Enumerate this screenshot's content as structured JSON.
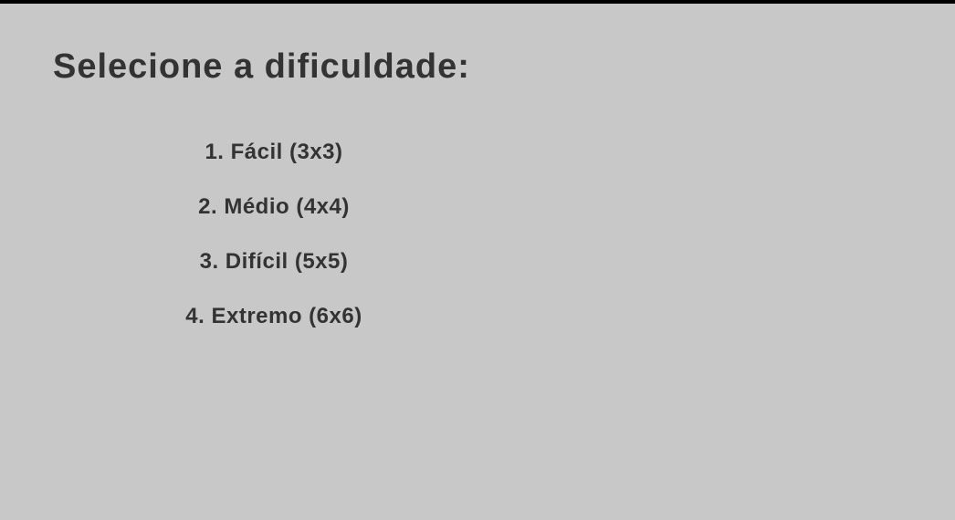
{
  "menu": {
    "title": "Selecione a dificuldade:",
    "options": [
      {
        "label": "1. Fácil (3x3)"
      },
      {
        "label": "2. Médio (4x4)"
      },
      {
        "label": "3. Difícil (5x5)"
      },
      {
        "label": "4. Extremo (6x6)"
      }
    ]
  },
  "colors": {
    "background": "#c8c8c8",
    "text": "#333333",
    "top_bar": "#000000"
  }
}
